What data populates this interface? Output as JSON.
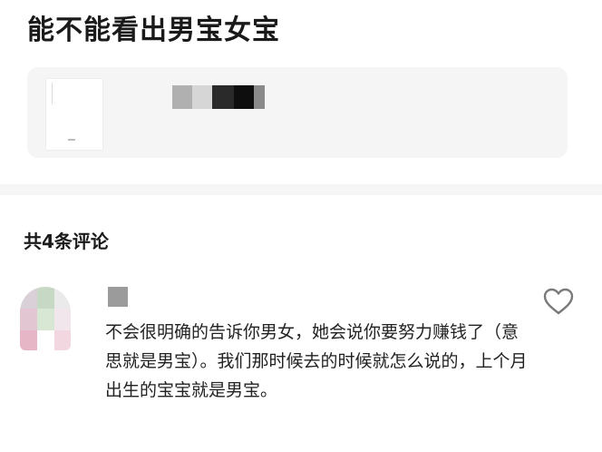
{
  "post": {
    "title": "能不能看出男宝女宝"
  },
  "attachment": {
    "blur_colors": [
      "#b0b0b0",
      "#d6d6d6",
      "#2a2a2a",
      "#0e0e0e",
      "#8a8a8a"
    ],
    "card_color": "#f5f5f5"
  },
  "comments_section": {
    "count_label": "共4条评论"
  },
  "comments": [
    {
      "avatar_colors": [
        "#d9d0d8",
        "#c7d9c4",
        "#eaeaea",
        "#e2c6d2",
        "#d8e6d4",
        "#f0e6ec",
        "#e6b6c6",
        "#ffffff",
        "#f2d6e0"
      ],
      "name_placeholder_color": "#9b9b9b",
      "text": "不会很明确的告诉你男女，她会说你要努力赚钱了（意思就是男宝）。我们那时候去的时候就怎么说的，上个月出生的宝宝就是男宝。",
      "like_icon": "heart-outline-icon"
    }
  ]
}
